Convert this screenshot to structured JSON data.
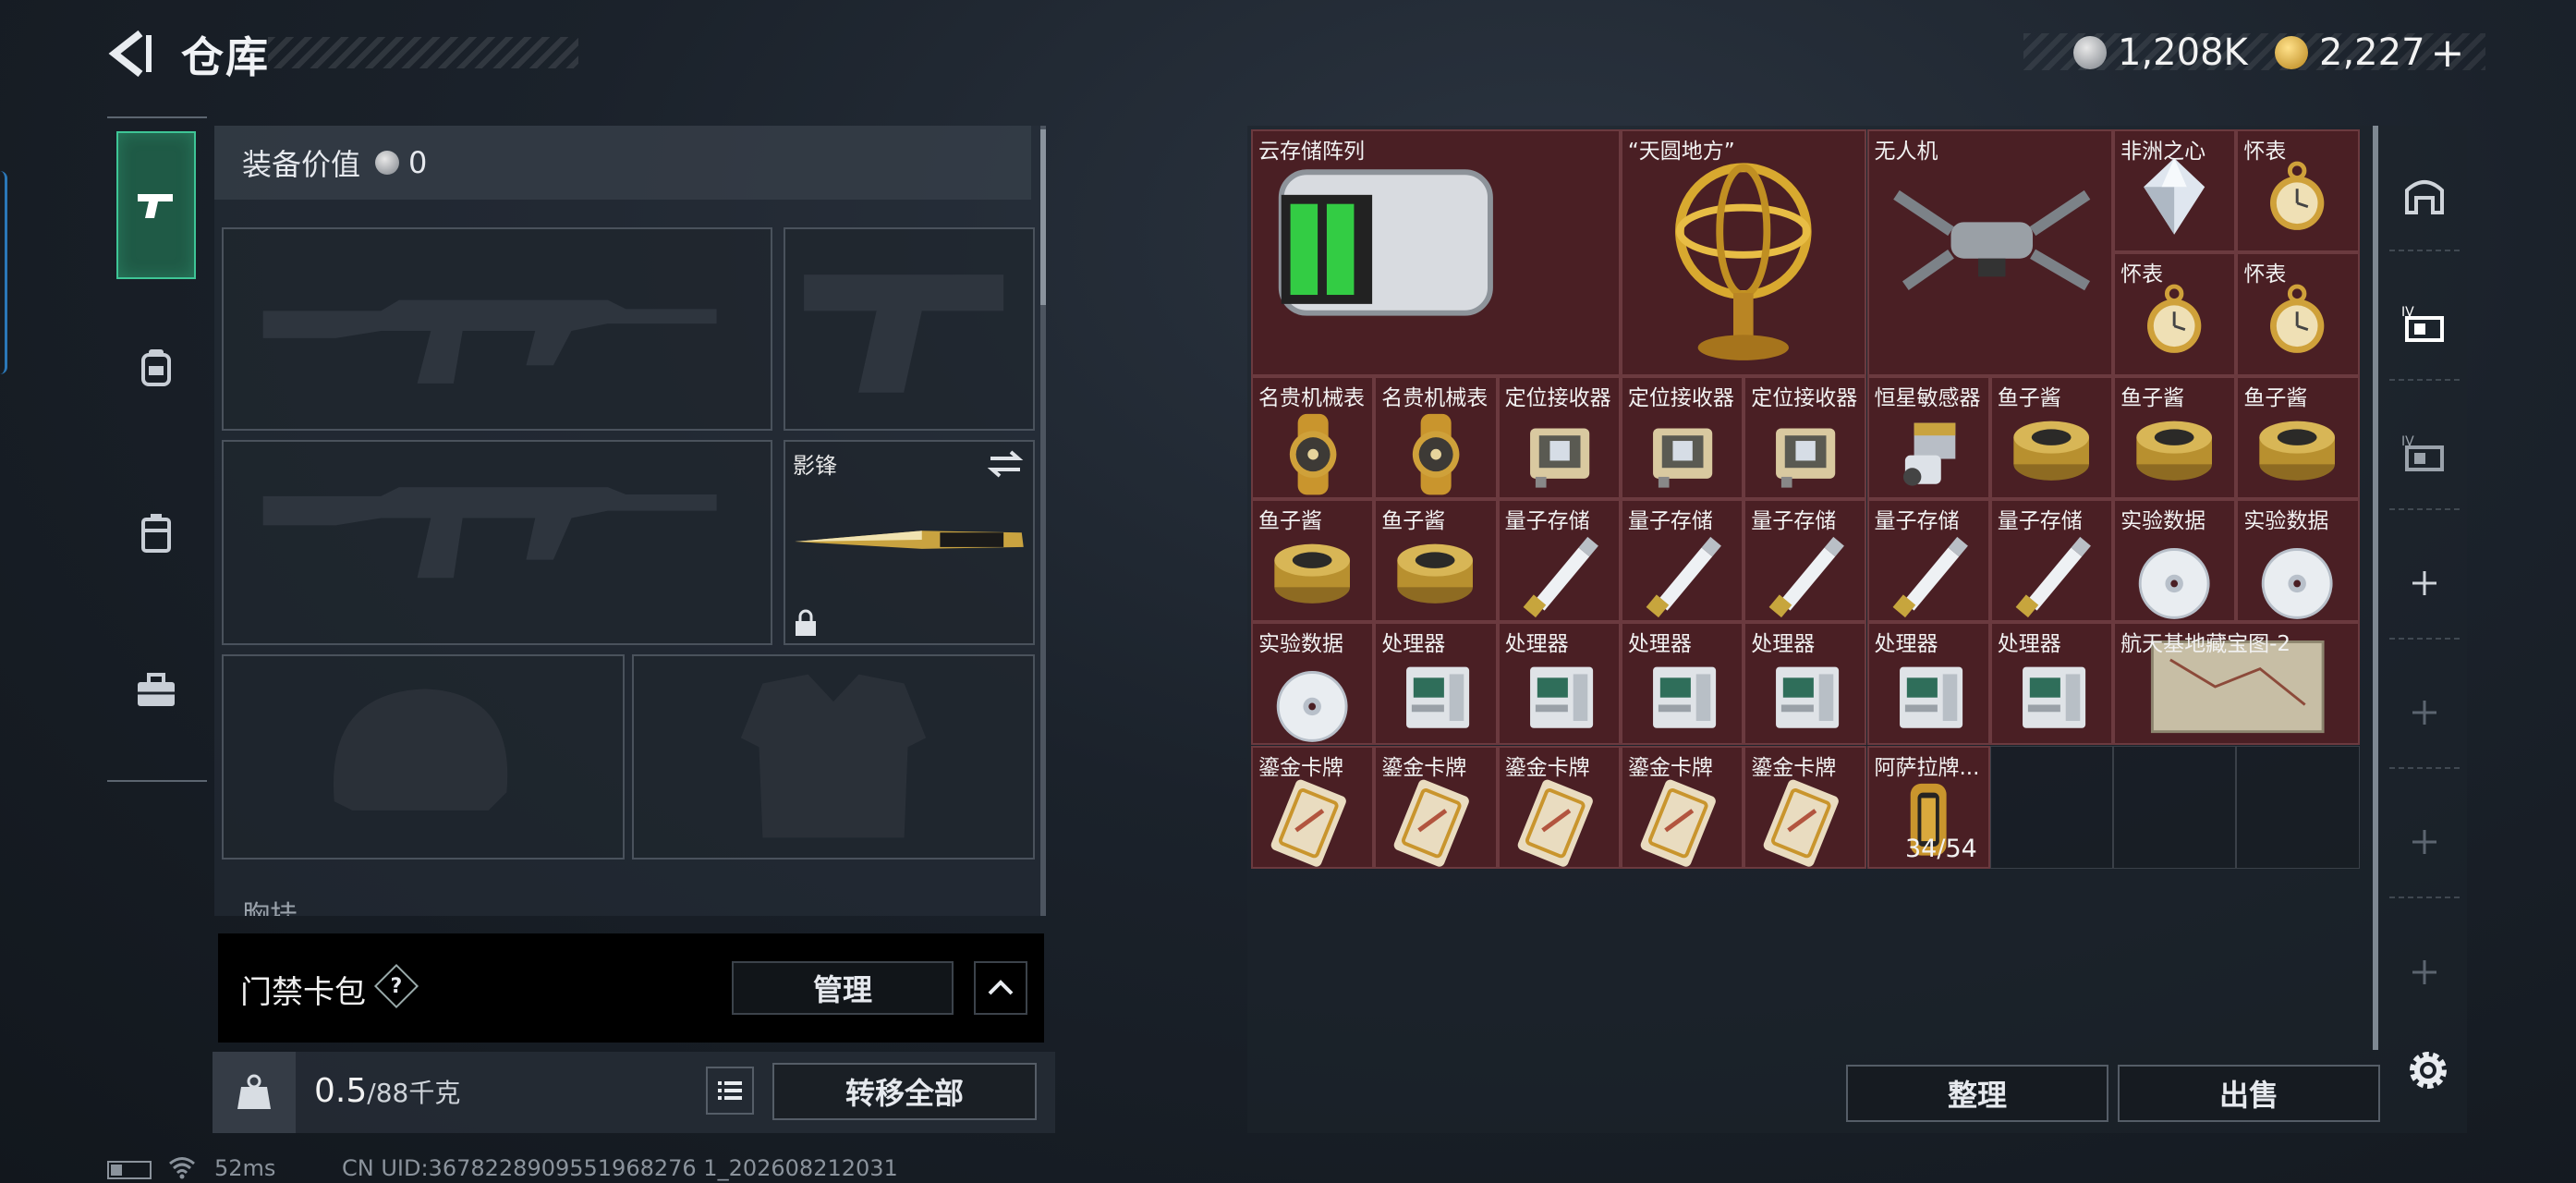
{
  "header": {
    "title": "仓库"
  },
  "currency": {
    "silver": "1,208K",
    "gold": "2,227",
    "plus": "+"
  },
  "equipment": {
    "value_label": "装备价值",
    "value": "0",
    "melee_name": "影锋",
    "chest_label": "胸挂"
  },
  "access_card": {
    "label": "门禁卡包",
    "help": "?",
    "manage_label": "管理"
  },
  "weight": {
    "current": "0.5",
    "max": "/88千克",
    "kg_label": "KG",
    "transfer_label": "转移全部"
  },
  "status": {
    "ping": "52ms",
    "uid": "CN UID:3678228909551968276 1_202608212031"
  },
  "storage": {
    "items": [
      {
        "label": "云存储阵列",
        "icon": "server-icon"
      },
      {
        "label": "“天圆地方”",
        "icon": "armillary-icon"
      },
      {
        "label": "无人机",
        "icon": "drone-icon"
      },
      {
        "label": "非洲之心",
        "icon": "diamond-icon"
      },
      {
        "label": "怀表",
        "icon": "pocket-watch-icon"
      },
      {
        "label": "怀表",
        "icon": "pocket-watch-icon"
      },
      {
        "label": "怀表",
        "icon": "pocket-watch-icon"
      },
      {
        "label": "名贵机械表",
        "icon": "wristwatch-icon"
      },
      {
        "label": "名贵机械表",
        "icon": "wristwatch-icon"
      },
      {
        "label": "定位接收器",
        "icon": "receiver-icon"
      },
      {
        "label": "定位接收器",
        "icon": "receiver-icon"
      },
      {
        "label": "定位接收器",
        "icon": "receiver-icon"
      },
      {
        "label": "恒星敏感器",
        "icon": "sensor-icon"
      },
      {
        "label": "鱼子酱",
        "icon": "caviar-icon"
      },
      {
        "label": "鱼子酱",
        "icon": "caviar-icon"
      },
      {
        "label": "鱼子酱",
        "icon": "caviar-icon"
      },
      {
        "label": "鱼子酱",
        "icon": "caviar-icon"
      },
      {
        "label": "鱼子酱",
        "icon": "caviar-icon"
      },
      {
        "label": "量子存储",
        "icon": "usb-drive-icon"
      },
      {
        "label": "量子存储",
        "icon": "usb-drive-icon"
      },
      {
        "label": "量子存储",
        "icon": "usb-drive-icon"
      },
      {
        "label": "量子存储",
        "icon": "usb-drive-icon"
      },
      {
        "label": "量子存储",
        "icon": "usb-drive-icon"
      },
      {
        "label": "实验数据",
        "icon": "disc-icon"
      },
      {
        "label": "实验数据",
        "icon": "disc-icon"
      },
      {
        "label": "实验数据",
        "icon": "disc-icon"
      },
      {
        "label": "处理器",
        "icon": "processor-icon"
      },
      {
        "label": "处理器",
        "icon": "processor-icon"
      },
      {
        "label": "处理器",
        "icon": "processor-icon"
      },
      {
        "label": "处理器",
        "icon": "processor-icon"
      },
      {
        "label": "处理器",
        "icon": "processor-icon"
      },
      {
        "label": "处理器",
        "icon": "processor-icon"
      },
      {
        "label": "航天基地藏宝图-2",
        "icon": "map-icon"
      },
      {
        "label": "鎏金卡牌",
        "icon": "card-icon"
      },
      {
        "label": "鎏金卡牌",
        "icon": "card-icon"
      },
      {
        "label": "鎏金卡牌",
        "icon": "card-icon"
      },
      {
        "label": "鎏金卡牌",
        "icon": "card-icon"
      },
      {
        "label": "鎏金卡牌",
        "icon": "card-icon"
      },
      {
        "label": "阿萨拉牌...",
        "icon": "battery-cell-icon",
        "count": "34/54"
      }
    ],
    "sort_label": "整理",
    "sell_label": "出售"
  },
  "colors": {
    "filled_cell": "#4a1f24",
    "accent_green": "#3ec596",
    "gold": "#c9a340"
  }
}
